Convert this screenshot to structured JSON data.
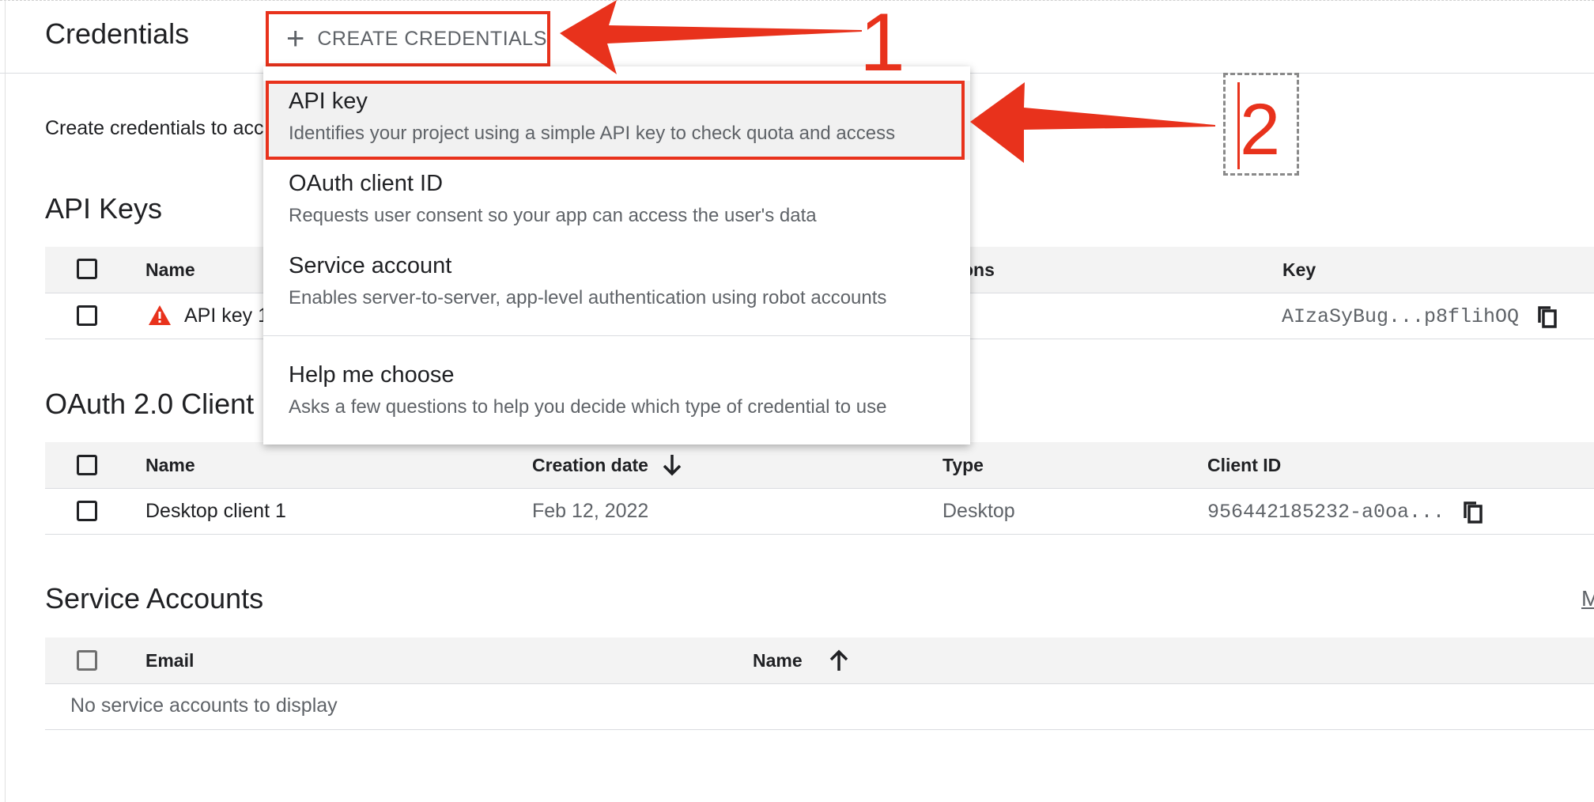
{
  "header": {
    "title": "Credentials",
    "create_button_label": "CREATE CREDENTIALS"
  },
  "intro_text": "Create credentials to acc",
  "api_keys": {
    "title": "API Keys",
    "columns": [
      "Name",
      "ons",
      "Key"
    ],
    "rows": [
      {
        "name": "API key 1",
        "key": "AIzaSyBug...p8flihOQ"
      }
    ]
  },
  "oauth": {
    "title": "OAuth 2.0 Client I",
    "columns": [
      "Name",
      "Creation date",
      "Type",
      "Client ID"
    ],
    "rows": [
      {
        "name": "Desktop client 1",
        "created": "Feb 12, 2022",
        "type": "Desktop",
        "client_id": "956442185232-a0oa..."
      }
    ]
  },
  "service_accounts": {
    "title": "Service Accounts",
    "columns": [
      "Email",
      "Name"
    ],
    "empty_text": "No service accounts to display",
    "manage_link": "M"
  },
  "menu": {
    "items": [
      {
        "title": "API key",
        "desc": "Identifies your project using a simple API key to check quota and access"
      },
      {
        "title": "OAuth client ID",
        "desc": "Requests user consent so your app can access the user's data"
      },
      {
        "title": "Service account",
        "desc": "Enables server-to-server, app-level authentication using robot accounts"
      },
      {
        "title": "Help me choose",
        "desc": "Asks a few questions to help you decide which type of credential to use"
      }
    ]
  },
  "annotations": {
    "step1": "1",
    "step2": "2",
    "accent_color": "#e8321c"
  },
  "icons": [
    "plus-icon",
    "warning-icon",
    "copy-icon",
    "arrow-down-icon",
    "arrow-up-icon",
    "checkbox-icon"
  ]
}
